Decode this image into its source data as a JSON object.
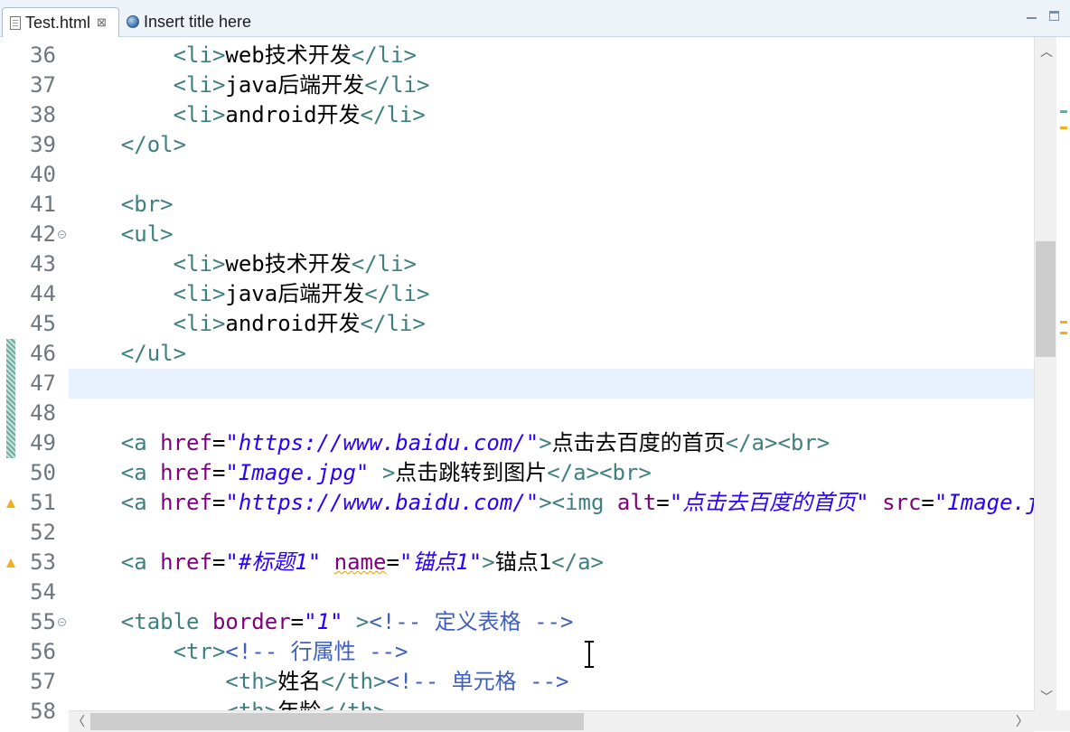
{
  "tabs": [
    {
      "label": "Test.html",
      "icon": "html-file-icon",
      "close_glyph": "⊠",
      "active": true
    },
    {
      "label": "Insert title here",
      "icon": "globe-icon",
      "active": false
    }
  ],
  "editor": {
    "current_line": 47,
    "lines": [
      {
        "n": "36",
        "segs": [
          [
            "x",
            "        "
          ],
          [
            "t",
            "<li>"
          ],
          [
            "x",
            "web技术开发"
          ],
          [
            "t",
            "</li>"
          ]
        ]
      },
      {
        "n": "37",
        "segs": [
          [
            "x",
            "        "
          ],
          [
            "t",
            "<li>"
          ],
          [
            "x",
            "java后端开发"
          ],
          [
            "t",
            "</li>"
          ]
        ]
      },
      {
        "n": "38",
        "segs": [
          [
            "x",
            "        "
          ],
          [
            "t",
            "<li>"
          ],
          [
            "x",
            "android开发"
          ],
          [
            "t",
            "</li>"
          ]
        ]
      },
      {
        "n": "39",
        "segs": [
          [
            "x",
            "    "
          ],
          [
            "t",
            "</ol>"
          ]
        ]
      },
      {
        "n": "40",
        "segs": []
      },
      {
        "n": "41",
        "segs": [
          [
            "x",
            "    "
          ],
          [
            "t",
            "<br>"
          ]
        ]
      },
      {
        "n": "42",
        "fold": true,
        "segs": [
          [
            "x",
            "    "
          ],
          [
            "t",
            "<ul>"
          ]
        ]
      },
      {
        "n": "43",
        "segs": [
          [
            "x",
            "        "
          ],
          [
            "t",
            "<li>"
          ],
          [
            "x",
            "web技术开发"
          ],
          [
            "t",
            "</li>"
          ]
        ]
      },
      {
        "n": "44",
        "segs": [
          [
            "x",
            "        "
          ],
          [
            "t",
            "<li>"
          ],
          [
            "x",
            "java后端开发"
          ],
          [
            "t",
            "</li>"
          ]
        ]
      },
      {
        "n": "45",
        "segs": [
          [
            "x",
            "        "
          ],
          [
            "t",
            "<li>"
          ],
          [
            "x",
            "android开发"
          ],
          [
            "t",
            "</li>"
          ]
        ]
      },
      {
        "n": "46",
        "segs": [
          [
            "x",
            "    "
          ],
          [
            "t",
            "</ul>"
          ]
        ]
      },
      {
        "n": "47",
        "segs": []
      },
      {
        "n": "48",
        "segs": []
      },
      {
        "n": "49",
        "segs": [
          [
            "x",
            "    "
          ],
          [
            "t",
            "<a "
          ],
          [
            "a",
            "href"
          ],
          [
            "x",
            "="
          ],
          [
            "v",
            "\"https://www.baidu.com/\""
          ],
          [
            "t",
            ">"
          ],
          [
            "x",
            "点击去百度的首页"
          ],
          [
            "t",
            "</a><br>"
          ]
        ]
      },
      {
        "n": "50",
        "segs": [
          [
            "x",
            "    "
          ],
          [
            "t",
            "<a "
          ],
          [
            "a",
            "href"
          ],
          [
            "x",
            "="
          ],
          [
            "v",
            "\"Image.jpg\""
          ],
          [
            "x",
            " "
          ],
          [
            "t",
            ">"
          ],
          [
            "x",
            "点击跳转到图片"
          ],
          [
            "t",
            "</a><br>"
          ]
        ]
      },
      {
        "n": "51",
        "warn": true,
        "segs": [
          [
            "x",
            "    "
          ],
          [
            "t",
            "<a "
          ],
          [
            "a",
            "href"
          ],
          [
            "x",
            "="
          ],
          [
            "v",
            "\"https://www.baidu.com/\""
          ],
          [
            "t",
            ">"
          ],
          [
            "t",
            "<img "
          ],
          [
            "a",
            "alt"
          ],
          [
            "x",
            "="
          ],
          [
            "v",
            "\"点击去百度的首页\""
          ],
          [
            "x",
            " "
          ],
          [
            "a",
            "src"
          ],
          [
            "x",
            "="
          ],
          [
            "v",
            "\"Image.jpg\""
          ]
        ]
      },
      {
        "n": "52",
        "segs": []
      },
      {
        "n": "53",
        "warn": true,
        "segs": [
          [
            "x",
            "    "
          ],
          [
            "t",
            "<a "
          ],
          [
            "a",
            "href"
          ],
          [
            "x",
            "="
          ],
          [
            "v",
            "\"#标题1\""
          ],
          [
            "x",
            " "
          ],
          [
            "a squig",
            "name"
          ],
          [
            "x",
            "="
          ],
          [
            "v",
            "\"锚点1\""
          ],
          [
            "t",
            ">"
          ],
          [
            "x",
            "锚点1"
          ],
          [
            "t",
            "</a>"
          ]
        ]
      },
      {
        "n": "54",
        "segs": []
      },
      {
        "n": "55",
        "fold": true,
        "segs": [
          [
            "x",
            "    "
          ],
          [
            "t",
            "<table "
          ],
          [
            "a",
            "border"
          ],
          [
            "x",
            "="
          ],
          [
            "v",
            "\"1\""
          ],
          [
            "x",
            " "
          ],
          [
            "t",
            ">"
          ],
          [
            "c",
            "<!-- 定义表格 -->"
          ]
        ]
      },
      {
        "n": "56",
        "segs": [
          [
            "x",
            "        "
          ],
          [
            "t",
            "<tr>"
          ],
          [
            "c",
            "<!-- 行属性 -->"
          ]
        ]
      },
      {
        "n": "57",
        "segs": [
          [
            "x",
            "            "
          ],
          [
            "t",
            "<th>"
          ],
          [
            "x",
            "姓名"
          ],
          [
            "t",
            "</th>"
          ],
          [
            "c",
            "<!-- 单元格 -->"
          ]
        ]
      },
      {
        "n": "58",
        "segs": [
          [
            "x",
            "            "
          ],
          [
            "t",
            "<th>"
          ],
          [
            "x",
            "年龄"
          ],
          [
            "t",
            "</th>"
          ]
        ]
      }
    ]
  },
  "colors": {
    "tag": "#3f7f7f",
    "attr": "#7f007f",
    "value": "#2a00ff",
    "comment": "#3f5fbf",
    "current_line": "#e8f2fe"
  }
}
